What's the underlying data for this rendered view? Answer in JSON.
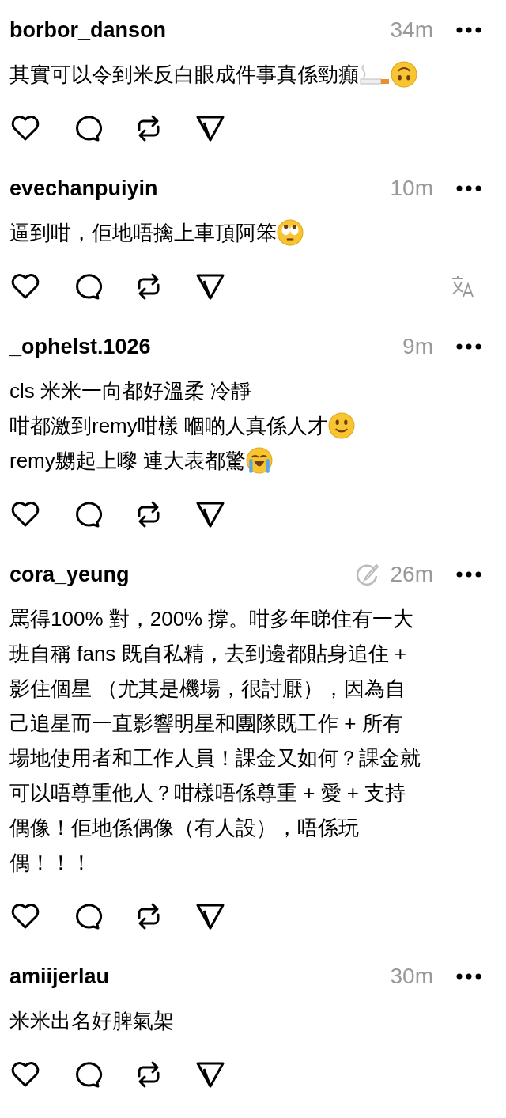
{
  "comments": [
    {
      "username": "borbor_danson",
      "time": "34m",
      "edited": false,
      "translatable": false,
      "lines": [
        [
          {
            "kind": "text",
            "text": "其實可以令到米反白眼成件事真係勁癲"
          },
          {
            "kind": "cigarette"
          },
          {
            "kind": "upside-down-face"
          }
        ]
      ]
    },
    {
      "username": "evechanpuiyin",
      "time": "10m",
      "edited": false,
      "translatable": true,
      "lines": [
        [
          {
            "kind": "text",
            "text": "逼到咁，佢地唔擒上車頂阿笨"
          },
          {
            "kind": "eye-roll-face"
          }
        ]
      ]
    },
    {
      "username": "_ophelst.1026",
      "time": "9m",
      "edited": false,
      "translatable": false,
      "lines": [
        [
          {
            "kind": "text",
            "text": "cls 米米一向都好溫柔 冷靜"
          }
        ],
        [
          {
            "kind": "text",
            "text": "咁都激到remy咁樣 嗰啲人真係人才"
          },
          {
            "kind": "smile-face"
          }
        ],
        [
          {
            "kind": "text",
            "text": "remy嬲起上嚟 連大表都驚"
          },
          {
            "kind": "crying-face"
          }
        ]
      ]
    },
    {
      "username": "cora_yeung",
      "time": "26m",
      "edited": true,
      "translatable": false,
      "lines": [
        [
          {
            "kind": "text",
            "text": "罵得100% 對，200% 撐。咁多年睇住有一大"
          }
        ],
        [
          {
            "kind": "text",
            "text": "班自稱 fans 既自私精，去到邊都貼身追住 +"
          }
        ],
        [
          {
            "kind": "text",
            "text": "影住個星 （尤其是機場，很討厭），因為自"
          }
        ],
        [
          {
            "kind": "text",
            "text": "己追星而一直影響明星和團隊既工作 + 所有"
          }
        ],
        [
          {
            "kind": "text",
            "text": "場地使用者和工作人員！課金又如何？課金就"
          }
        ],
        [
          {
            "kind": "text",
            "text": "可以唔尊重他人？咁樣唔係尊重 + 愛 + 支持"
          }
        ],
        [
          {
            "kind": "text",
            "text": "偶像！佢地係偶像（有人設），唔係玩"
          }
        ],
        [
          {
            "kind": "text",
            "text": "偶！！！"
          }
        ]
      ]
    },
    {
      "username": "amiijerlau",
      "time": "30m",
      "edited": false,
      "translatable": false,
      "lines": [
        [
          {
            "kind": "text",
            "text": "米米出名好脾氣架"
          }
        ]
      ]
    }
  ]
}
